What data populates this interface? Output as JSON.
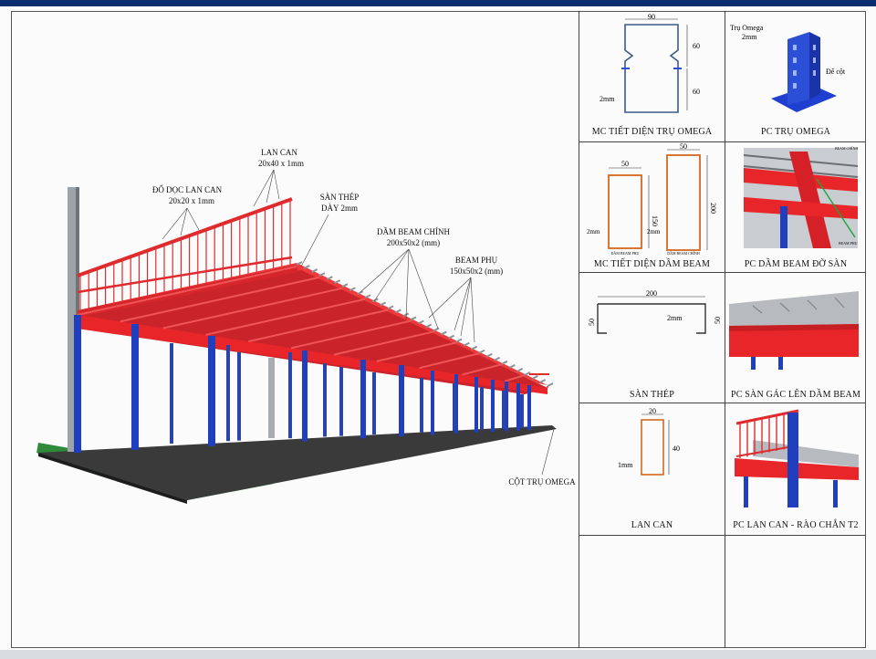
{
  "main": {
    "labels": {
      "do_doc_title": "ĐỐ DỌC LAN CAN",
      "do_doc_size": "20x20 x 1mm",
      "lan_can_title": "LAN CAN",
      "lan_can_size": "20x40 x 1mm",
      "san_thep_title": "SÀN THÉP",
      "san_thep_size": "DÀY 2mm",
      "dam_chinh_title": "DẦM BEAM CHÍNH",
      "dam_chinh_size": "200x50x2 (mm)",
      "beam_phu_title": "BEAM PHỤ",
      "beam_phu_size": "150x50x2 (mm)",
      "cot_tru": "CỘT TRỤ OMEGA"
    }
  },
  "details": [
    {
      "caption": "MC TIẾT DIỆN TRỤ OMEGA",
      "dims": {
        "width": "90",
        "side_a": "60",
        "side_b": "60",
        "thick": "2mm"
      }
    },
    {
      "caption": "PC TRỤ OMEGA",
      "labels": {
        "tru": "Trụ Omega",
        "tru_t": "2mm",
        "de_cot": "Đế cột"
      }
    },
    {
      "caption": "MC TIẾT DIỆN DẦM BEAM",
      "dims": {
        "w1": "50",
        "w2": "50",
        "h1": "150",
        "h2": "200",
        "t1": "2mm",
        "t2": "2mm",
        "name1": "DẦM BEAM PHỤ",
        "name2": "DẦM BEAM CHÍNH"
      }
    },
    {
      "caption": "PC DẦM BEAM ĐỠ SÀN",
      "labels": {
        "top": "BEAM CHÍNH",
        "bottom": "BEAM PHỤ"
      }
    },
    {
      "caption": "SÀN THÉP",
      "dims": {
        "width": "200",
        "left": "50",
        "right": "50",
        "thick": "2mm"
      }
    },
    {
      "caption": "PC SÀN GÁC LÊN DẦM BEAM"
    },
    {
      "caption": "LAN CAN",
      "dims": {
        "width": "20",
        "height": "40",
        "thick": "1mm"
      }
    },
    {
      "caption": "PC LAN CAN - RÀO CHẮN T2"
    }
  ],
  "colors": {
    "beam": "#e8262a",
    "column": "#1f3fbf",
    "rail": "#e02b2e",
    "ground": "#2f8a3a",
    "slab": "#3a3a3a",
    "profile": "#d2691e",
    "omega": "#2b4fd6",
    "frame": "#0a2d6e"
  }
}
